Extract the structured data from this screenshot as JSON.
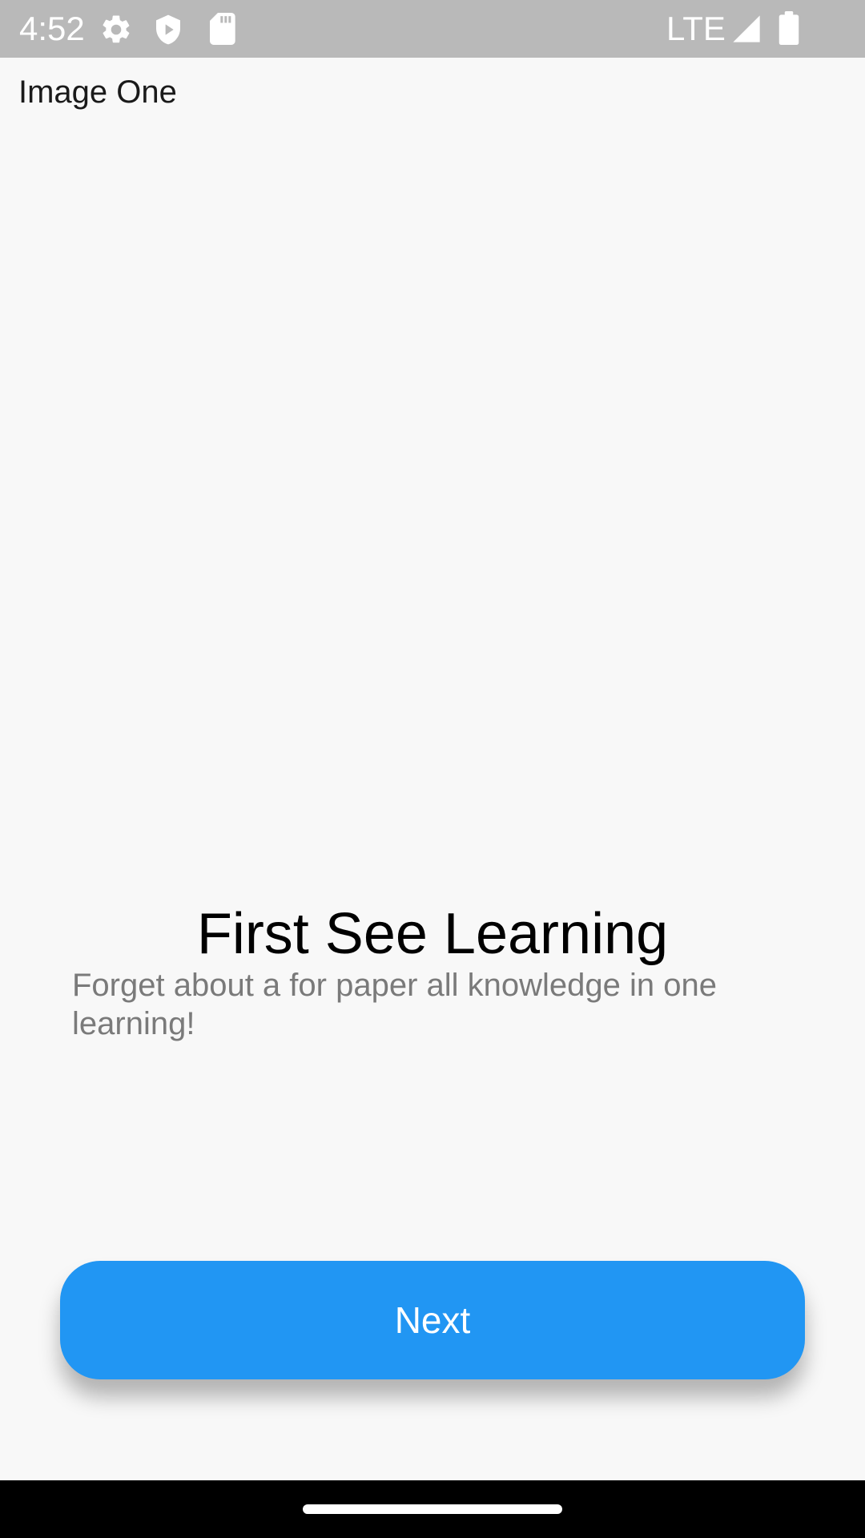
{
  "status_bar": {
    "time": "4:52",
    "network": "LTE",
    "icons": [
      "gear-icon",
      "shield-play-icon",
      "sd-card-icon",
      "signal-icon",
      "battery-icon"
    ]
  },
  "content": {
    "image_label": "Image One",
    "headline": "First See Learning",
    "subtext": "Forget about a for paper all knowledge in one learning!"
  },
  "actions": {
    "next_label": "Next"
  },
  "colors": {
    "status_bar_bg": "#b9b9b9",
    "background": "#f8f8f8",
    "accent": "#2196f3",
    "nav_bar_bg": "#000000"
  }
}
